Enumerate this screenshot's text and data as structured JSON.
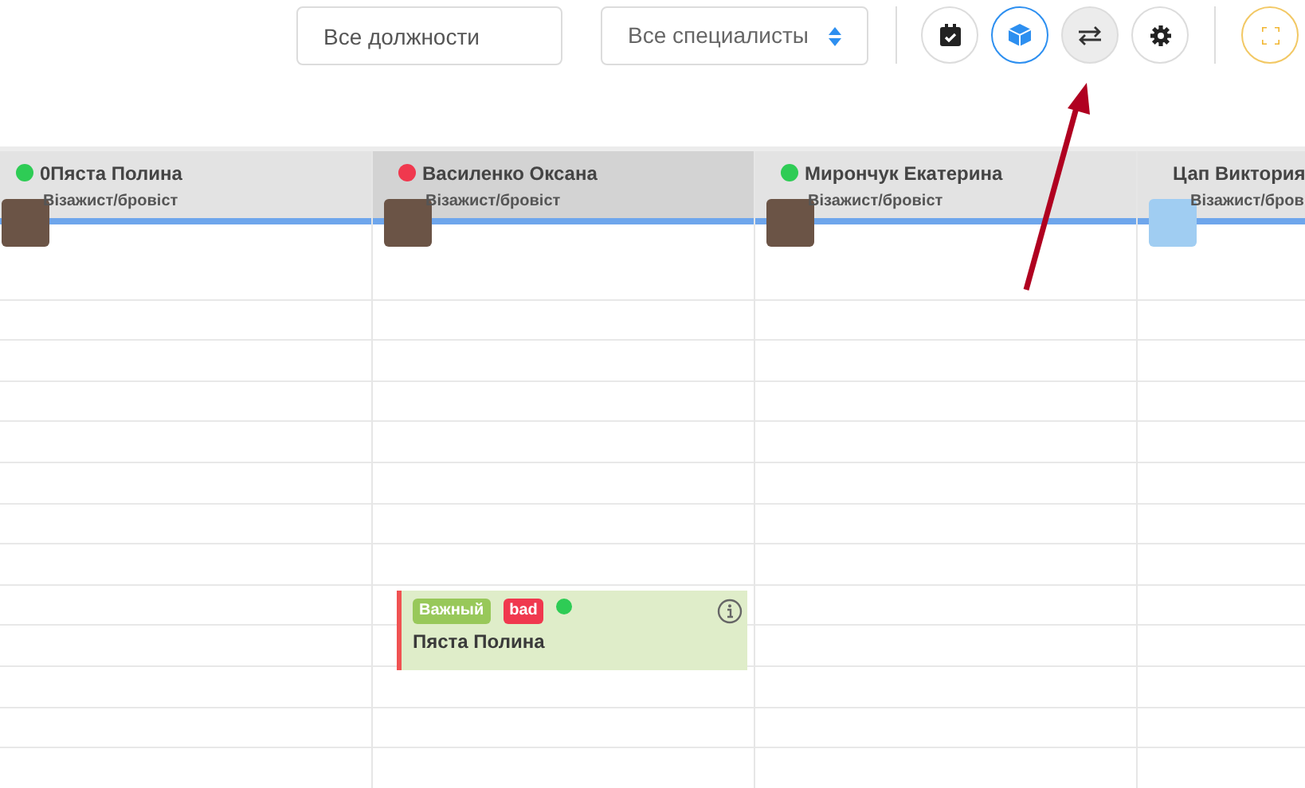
{
  "toolbar": {
    "position_filter": {
      "placeholder": "Все должности"
    },
    "specialist_select": {
      "value": "Все специалисты"
    },
    "buttons": [
      {
        "kind": "calendar",
        "selected": false,
        "highlighted": false
      },
      {
        "kind": "cube",
        "selected": true,
        "highlighted": false
      },
      {
        "kind": "swap",
        "selected": false,
        "highlighted": true
      },
      {
        "kind": "settings",
        "selected": false,
        "highlighted": false
      }
    ],
    "fullscreen_button": {
      "kind": "fullscreen"
    }
  },
  "columns": [
    {
      "name": "0Пяста Полина",
      "role": "Візажист/бровіст",
      "color": "#2ecc55",
      "selected": false,
      "photo": true
    },
    {
      "name": "Василенко Оксана",
      "role": "Візажист/бровіст",
      "color": "#f0384e",
      "selected": true,
      "photo": true,
      "appointments": [
        {
          "tags": [
            {
              "text": "Важный",
              "color": "#98c85a"
            },
            {
              "text": "bad",
              "color": "#f0384e"
            }
          ],
          "color": "#2ecc55",
          "client": "Пяста Полина"
        }
      ]
    },
    {
      "name": "Мирончук Екатерина",
      "role": "Візажист/бровіст",
      "color": "#2ecc55",
      "selected": false,
      "photo": true
    },
    {
      "name": "Цап Виктория",
      "role": "Візажист/бров",
      "selected": false,
      "photo": false
    }
  ]
}
